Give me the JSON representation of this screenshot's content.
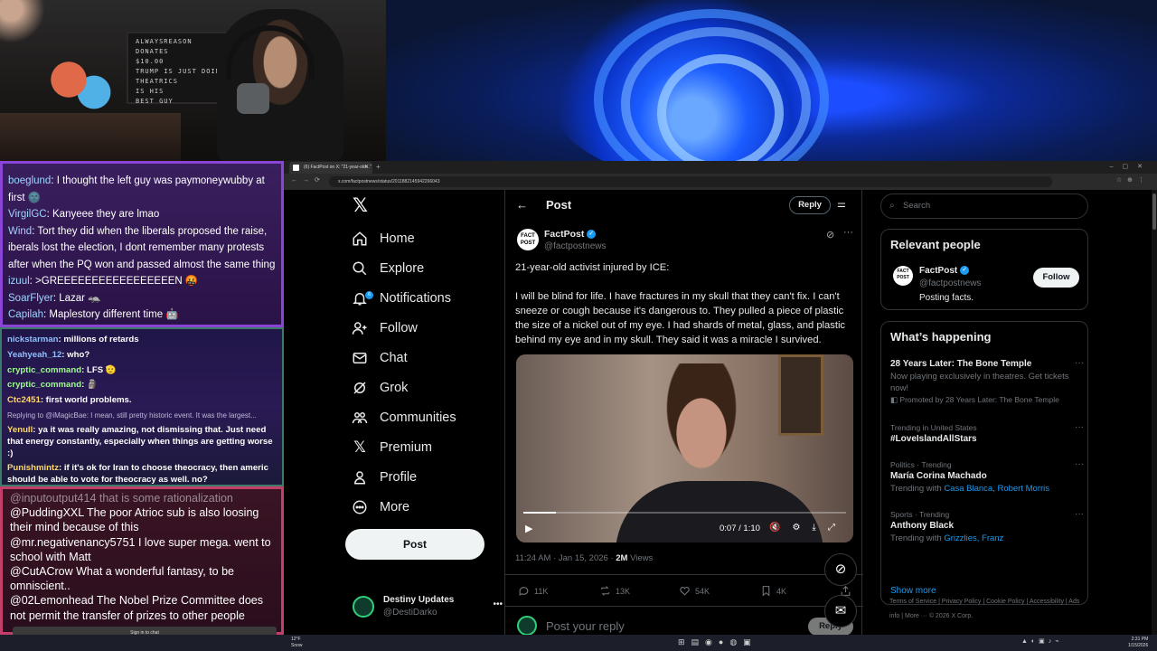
{
  "webcam": {
    "board_lines": [
      "ALWAYSREASON DONATES",
      "$10.00",
      "TRUMP IS JUST DOING",
      "THEATRICS",
      "IS HIS",
      "BEST GUY"
    ]
  },
  "chat_top": [
    {
      "name": "boeglund",
      "text": ": I thought the left guy was paymoneywubby at first 🌚"
    },
    {
      "name": "VirgilGC",
      "text": ": Kanyeee they are lmao"
    },
    {
      "name": "Wind",
      "text": ": Tort they did when the liberals proposed the raise, iberals lost the election, I dont remember many protests after when the PQ won and passed almost the same thing"
    },
    {
      "name": "izuul",
      "text": ": >GREEEEEEEEEEEEEEEEEN 🤬"
    },
    {
      "name": "SoarFlyer",
      "text": ": Lazar 🦡"
    },
    {
      "name": "Capilah",
      "text": ": Maplestory different time 🤖"
    }
  ],
  "chat_mid": [
    {
      "name": "nickstarman",
      "text": ": millions of retards",
      "color": "b"
    },
    {
      "name": "Yeahyeah_12",
      "text": ": who?",
      "color": "b"
    },
    {
      "name": "cryptic_command",
      "text": ": LFS 🫡",
      "color": "g"
    },
    {
      "name": "cryptic_command",
      "text": ": 🗿",
      "color": "g"
    },
    {
      "name": "Ctc2451",
      "text": ": first world problems.",
      "color": "y"
    },
    {
      "name": "",
      "text": "Replying to @iMagicBae: I mean, still pretty historic event. It was the largest...",
      "color": "reply"
    },
    {
      "name": "Yenull",
      "text": ": ya it was really amazing, not dismissing that. Just need that energy constantly, especially when things are getting worse :)",
      "color": "y"
    },
    {
      "name": "Punishmintz",
      "text": ": if it's ok for Iran to choose theocracy, then americ should be able to vote for theocracy as well. no?",
      "color": "y"
    }
  ],
  "chat_bot": [
    {
      "name": "@inputoutput414",
      "text": " that is some rationalization",
      "cut": true
    },
    {
      "name": "@PuddingXXL",
      "text": " The poor Atrioc sub is also loosing their mind because of this"
    },
    {
      "name": "@mr.negativenancy5751",
      "text": " I love super mega. went to school with Matt"
    },
    {
      "name": "@CutACrow",
      "text": " What a wonderful fantasy, to be omniscient.."
    },
    {
      "name": "@02Lemonhead",
      "text": " The Nobel Prize Committee does not permit the transfer of prizes to other people"
    }
  ],
  "signin": "Sign in to chat",
  "browser": {
    "tab_title": "(6) FactPost on X: \"21-year-old...\"",
    "url": "x.com/factpostnews/status/2011882145942266043"
  },
  "nav": {
    "items": [
      {
        "label": "Home",
        "icon": "home-icon"
      },
      {
        "label": "Explore",
        "icon": "search-icon"
      },
      {
        "label": "Notifications",
        "icon": "bell-icon",
        "badge": "6"
      },
      {
        "label": "Follow",
        "icon": "add-person-icon"
      },
      {
        "label": "Chat",
        "icon": "mail-icon"
      },
      {
        "label": "Grok",
        "icon": "grok-icon"
      },
      {
        "label": "Communities",
        "icon": "people-icon"
      },
      {
        "label": "Premium",
        "icon": "x-icon"
      },
      {
        "label": "Profile",
        "icon": "person-icon"
      },
      {
        "label": "More",
        "icon": "more-circle-icon"
      }
    ],
    "post_label": "Post",
    "account_name": "Destiny Updates",
    "account_handle": "@DestiDarko"
  },
  "main": {
    "header_title": "Post",
    "reply_label": "Reply",
    "author_name": "FactPost",
    "author_handle": "@factpostnews",
    "avatar_text": "FACT POST",
    "text": "21-year-old activist injured by ICE:\n\nI will be blind for life. I have fractures in my skull that they can't fix. I can't sneeze or cough because it's dangerous to. They pulled a piece of plastic the size of a nickel out of my eye. I had shards of metal, glass, and plastic behind my eye and in my skull. They said it was a miracle I survived.",
    "video_time": "0:07 / 1:10",
    "video_progress": 0.1,
    "timestamp": "11:24 AM · Jan 15, 2026 · ",
    "views_count": "2M",
    "views_label": " Views",
    "replies": "11K",
    "reposts": "13K",
    "likes": "54K",
    "bookmarks": "4K",
    "reply_placeholder": "Post your reply",
    "reply_button": "Reply"
  },
  "side": {
    "search_placeholder": "Search",
    "relevant_title": "Relevant people",
    "rp_name": "FactPost",
    "rp_handle": "@factpostnews",
    "rp_bio": "Posting facts.",
    "follow_label": "Follow",
    "happening_title": "What’s happening",
    "trends": [
      {
        "small": "",
        "title": "28 Years Later: The Bone Temple",
        "desc": "Now playing exclusively in theatres. Get tickets now!",
        "promo": "Promoted by 28 Years Later: The Bone Temple"
      },
      {
        "small": "Trending in United States",
        "title": "#LoveIslandAllStars"
      },
      {
        "small": "Politics · Trending",
        "title": "María Corina Machado",
        "with_label": "Trending with ",
        "with": "Casa Blanca, Robert Morris"
      },
      {
        "small": "Sports · Trending",
        "title": "Anthony Black",
        "with_label": "Trending with ",
        "with": "Grizzlies, Franz"
      }
    ],
    "show_more": "Show more",
    "footer": "Terms of Service  |  Privacy Policy  |  Cookie Policy  |  Accessibility  |  Ads info  |  More ···  © 2026 X Corp."
  },
  "taskbar": {
    "weather_temp": "12°F",
    "weather_desc": "Snow",
    "time": "2:31 PM",
    "date": "1/15/2026"
  }
}
